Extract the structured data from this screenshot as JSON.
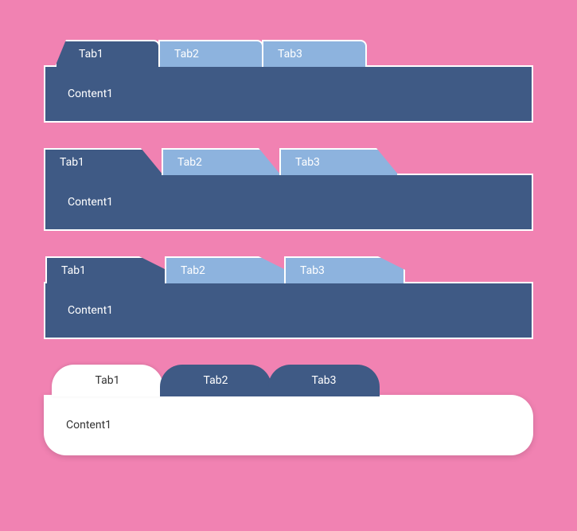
{
  "widgets": [
    {
      "style": "slant-left",
      "tabs": [
        "Tab1",
        "Tab2",
        "Tab3"
      ],
      "active_index": 0,
      "content": "Content1"
    },
    {
      "style": "slant-right",
      "tabs": [
        "Tab1",
        "Tab2",
        "Tab3"
      ],
      "active_index": 0,
      "content": "Content1"
    },
    {
      "style": "pentagon",
      "tabs": [
        "Tab1",
        "Tab2",
        "Tab3"
      ],
      "active_index": 0,
      "content": "Content1"
    },
    {
      "style": "rounded",
      "tabs": [
        "Tab1",
        "Tab2",
        "Tab3"
      ],
      "active_index": 0,
      "content": "Content1"
    }
  ],
  "colors": {
    "page_bg": "#f182b2",
    "tab_active": "#3f5a85",
    "tab_inactive": "#8db3de",
    "tab_border": "#ffffff",
    "rounded_active_bg": "#ffffff",
    "rounded_inactive_bg": "#3f5a85"
  }
}
